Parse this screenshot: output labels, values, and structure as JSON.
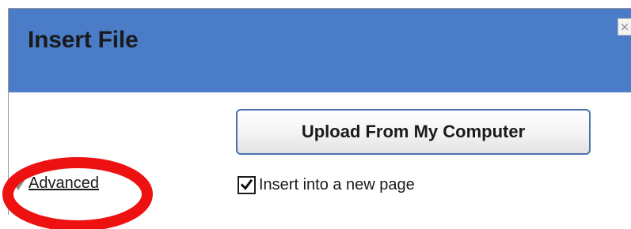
{
  "dialog": {
    "title": "Insert File",
    "close_label": "×",
    "upload_label": "Upload From My Computer",
    "insert_new_page": {
      "label": "Insert into a new page",
      "checked": true
    },
    "advanced_label": "Advanced"
  },
  "colors": {
    "titlebar": "#4a7cc7",
    "upload_border": "#4a72b0",
    "highlight": "#ee1111"
  },
  "icons": {
    "close": "close-icon",
    "checkmark": "checkmark-icon",
    "expand": "expand-triangle-icon"
  }
}
